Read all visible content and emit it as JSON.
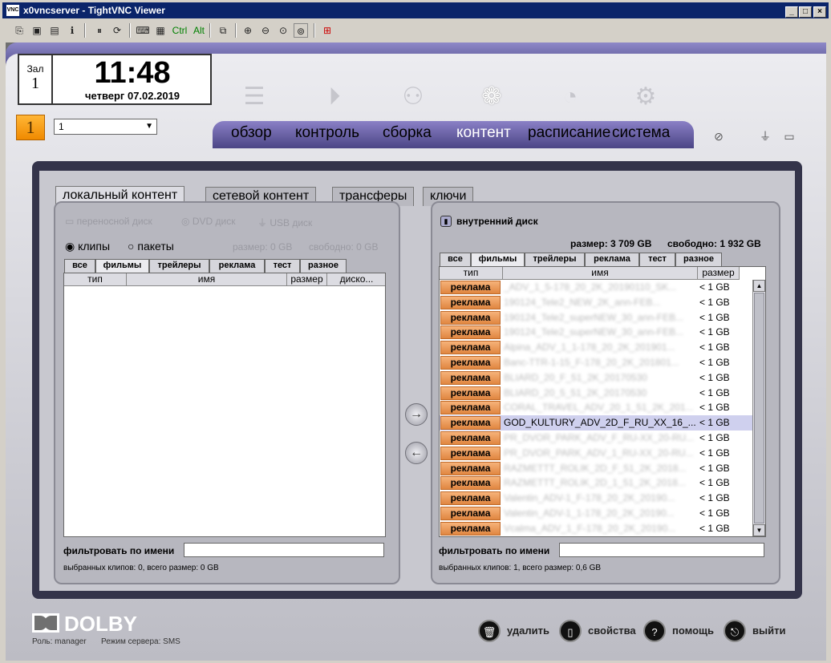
{
  "window": {
    "title": "x0vncserver - TightVNC Viewer",
    "toolbar_text": [
      "Ctrl",
      "Alt"
    ]
  },
  "clock": {
    "hall_label": "Зал",
    "hall_number": "1",
    "time": "11:48",
    "date": "четверг 07.02.2019"
  },
  "hall_badge": "1",
  "hall_select": {
    "value": "1"
  },
  "nav": {
    "tabs": [
      "обзор",
      "контроль",
      "сборка",
      "контент",
      "расписание",
      "система"
    ],
    "active": "контент"
  },
  "content_tabs": [
    "локальный контент",
    "сетевой контент",
    "трансферы",
    "ключи"
  ],
  "left": {
    "disks": [
      "переносной диск",
      "DVD диск",
      "USB диск"
    ],
    "radio_clips": "клипы",
    "radio_packs": "пакеты",
    "size": "размер: 0 GB",
    "free": "свободно: 0 GB",
    "subtabs": [
      "все",
      "фильмы",
      "трейлеры",
      "реклама",
      "тест",
      "разное"
    ],
    "columns": [
      "тип",
      "имя",
      "размер",
      "диско..."
    ],
    "filter_label": "фильтровать по имени",
    "status": "выбранных клипов: 0, всего размер: 0 GB"
  },
  "right": {
    "disk": "внутренний диск",
    "size": "размер: 3 709 GB",
    "free": "свободно: 1 932 GB",
    "subtabs": [
      "все",
      "фильмы",
      "трейлеры",
      "реклама",
      "тест",
      "разное"
    ],
    "columns": [
      "тип",
      "имя",
      "размер"
    ],
    "rows": [
      {
        "type": "реклама",
        "name": "_ADV_1_5-178_20_2K_20190110_SK...",
        "size": "< 1 GB"
      },
      {
        "type": "реклама",
        "name": "190124_Tele2_NEW_2K_ann-FEB...",
        "size": "< 1 GB"
      },
      {
        "type": "реклама",
        "name": "190124_Tele2_superNEW_30_ann-FEB...",
        "size": "< 1 GB"
      },
      {
        "type": "реклама",
        "name": "190124_Tele2_superNEW_30_ann-FEB...",
        "size": "< 1 GB"
      },
      {
        "type": "реклама",
        "name": "Alpina_ADV_1_1-178_20_2K_201901...",
        "size": "< 1 GB"
      },
      {
        "type": "реклама",
        "name": "Banc-TTR-1-15_F-178_20_2K_201801...",
        "size": "< 1 GB"
      },
      {
        "type": "реклама",
        "name": "BLIARD_20_F_51_2K_20170530",
        "size": "< 1 GB"
      },
      {
        "type": "реклама",
        "name": "BLIARD_20_5_51_2K_20170530",
        "size": "< 1 GB"
      },
      {
        "type": "реклама",
        "name": "CORAL_TRAVEL_ADV_20_1_51_2K_201...",
        "size": "< 1 GB"
      },
      {
        "type": "реклама",
        "name": "GOD_KULTURY_ADV_2D_F_RU_XX_16_...",
        "size": "< 1 GB",
        "selected": true
      },
      {
        "type": "реклама",
        "name": "PR_DVOR_PARK_ADV_F_RU-XX_20-RU...",
        "size": "< 1 GB"
      },
      {
        "type": "реклама",
        "name": "PR_DVOR_PARK_ADV_1_RU-XX_20-RU...",
        "size": "< 1 GB"
      },
      {
        "type": "реклама",
        "name": "RAZMETTT_ROLIK_2D_F_51_2K_2018...",
        "size": "< 1 GB"
      },
      {
        "type": "реклама",
        "name": "RAZMETTT_ROLIK_2D_1_51_2K_2018...",
        "size": "< 1 GB"
      },
      {
        "type": "реклама",
        "name": "Valentin_ADV-1_F-178_20_2K_20190...",
        "size": "< 1 GB"
      },
      {
        "type": "реклама",
        "name": "Valentin_ADV-1_1-178_20_2K_20190...",
        "size": "< 1 GB"
      },
      {
        "type": "реклама",
        "name": "Vcalma_ADV_1_F-178_20_2K_20190...",
        "size": "< 1 GB"
      }
    ],
    "filter_label": "фильтровать по имени",
    "status": "выбранных клипов: 1, всего размер: 0,6 GB"
  },
  "footer": {
    "brand": "DOLBY",
    "role": "Роль: manager",
    "server_mode": "Режим сервера: SMS",
    "actions": [
      "удалить",
      "свойства",
      "помощь",
      "выйти"
    ]
  }
}
